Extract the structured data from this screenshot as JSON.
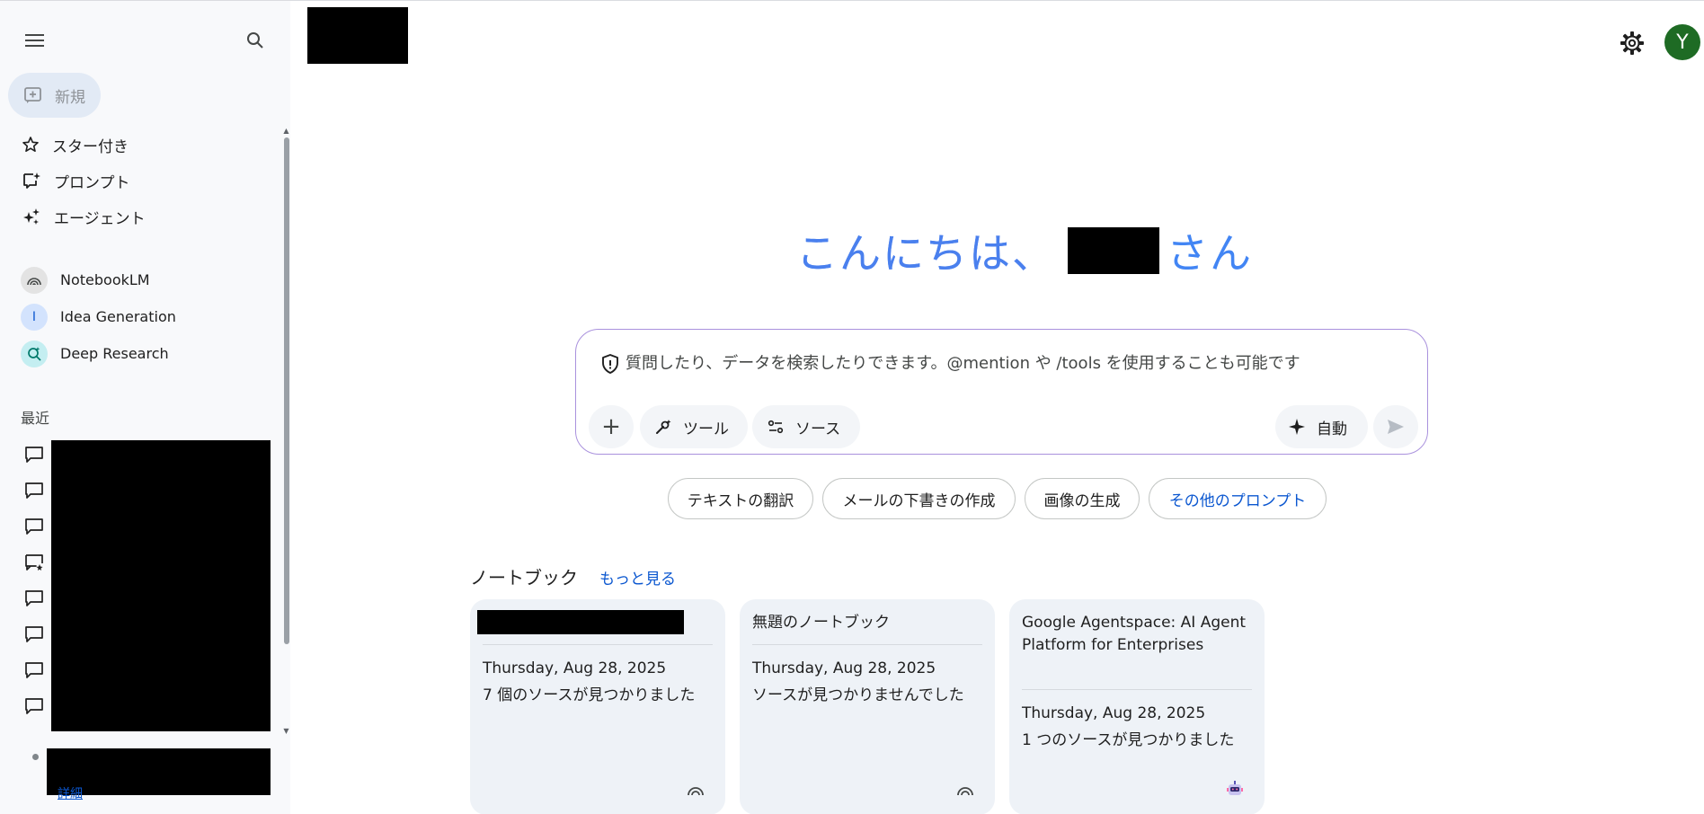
{
  "sidebar": {
    "new_label": "新規",
    "nav": [
      {
        "label": "スター付き",
        "icon": "star-icon"
      },
      {
        "label": "プロンプト",
        "icon": "prompt-icon"
      },
      {
        "label": "エージェント",
        "icon": "sparkle-icon"
      }
    ],
    "agents": [
      {
        "label": "NotebookLM",
        "avatar": "",
        "bg": "#e3e3e3",
        "fg": "#444746",
        "icon": "notebooklm-icon"
      },
      {
        "label": "Idea Generation",
        "avatar": "I",
        "bg": "#d3e3fd",
        "fg": "#0b57d0",
        "icon": "idea-generation-avatar"
      },
      {
        "label": "Deep Research",
        "avatar": "",
        "bg": "#c4eef1",
        "fg": "#00796b",
        "icon": "deep-research-icon"
      }
    ],
    "recent_heading": "最近",
    "bottom_link": "詳細"
  },
  "header": {
    "avatar_letter": "Y",
    "avatar_color": "#1e6b24"
  },
  "greeting": {
    "prefix": "こんにちは、",
    "suffix": "さん"
  },
  "composer": {
    "placeholder": "質問したり、データを検索したりできます。@mention や /tools を使用することも可能です",
    "tools_label": "ツール",
    "sources_label": "ソース",
    "auto_label": "自動"
  },
  "suggestions": {
    "translate": "テキストの翻訳",
    "email": "メールの下書きの作成",
    "image": "画像の生成",
    "more": "その他のプロンプト"
  },
  "notebooks": {
    "heading": "ノートブック",
    "more_label": "もっと見る",
    "cards": [
      {
        "title": "",
        "date": "Thursday, Aug 28, 2025",
        "sources": "7 個のソースが見つかりました"
      },
      {
        "title": "無題のノートブック",
        "date": "Thursday, Aug 28, 2025",
        "sources": "ソースが見つかりませんでした"
      },
      {
        "title": "Google Agentspace: AI Agent Platform for Enterprises",
        "date": "Thursday, Aug 28, 2025",
        "sources": "1 つのソースが見つかりました"
      }
    ]
  },
  "colors": {
    "accent": "#0b57d0",
    "greeting": "#4285f4",
    "composer_border": "#a991dd",
    "sidebar_bg": "#f8f9fb",
    "card_bg": "#eef2f7"
  }
}
